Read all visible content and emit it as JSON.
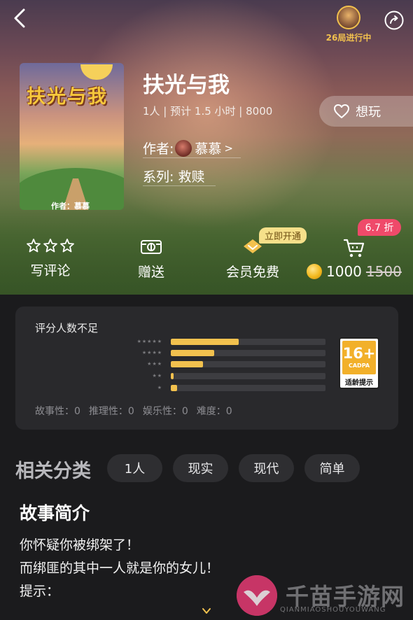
{
  "header": {
    "players_text": "26局进行中"
  },
  "game": {
    "cover_title": "扶光与我",
    "cover_author": "作者：慕慕",
    "title": "扶光与我",
    "meta": "1人 | 预计 1.5 小时 | 8000",
    "want_label": "想玩",
    "author_key": "作者:",
    "author_name": "慕慕",
    "author_chevron": ">",
    "series": "系列: 救赎"
  },
  "actions": {
    "review": "写评论",
    "gift": "赠送",
    "vip_free": "会员免费",
    "vip_tag": "立即开通",
    "discount": "6.7 折",
    "price": "1000",
    "old_price": "1500"
  },
  "rating": {
    "title": "评分人数不足",
    "rows": [
      {
        "stars": "★★★★★",
        "fraction": 0.44
      },
      {
        "stars": "★★★★",
        "fraction": 0.28
      },
      {
        "stars": "★★★",
        "fraction": 0.21
      },
      {
        "stars": "★★",
        "fraction": 0.02
      },
      {
        "stars": "★",
        "fraction": 0.04
      }
    ],
    "age_rating": "16+",
    "age_org": "CADPA",
    "age_hint": "适龄提示",
    "metrics": [
      "故事性：0",
      "推理性：0",
      "娱乐性：0",
      "难度：0"
    ]
  },
  "categories": {
    "label": "相关分类",
    "tags": [
      "1人",
      "现实",
      "现代",
      "简单"
    ]
  },
  "intro": {
    "title": "故事简介",
    "lines": [
      "你怀疑你被绑架了！",
      "而绑匪的其中一人就是你的女儿！",
      "提示："
    ]
  },
  "watermark": {
    "cn": "千苗手游网",
    "en": "QIANMIAOSHOUYOUWANG"
  },
  "colors": {
    "accent": "#f2c14e",
    "discount": "#ef4a6a",
    "background": "#1b1b1d",
    "card": "#29292c"
  }
}
